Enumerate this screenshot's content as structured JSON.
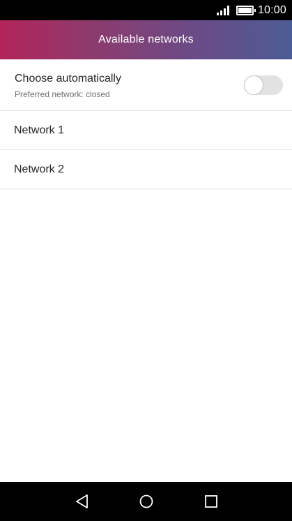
{
  "status_bar": {
    "time": "10:00",
    "icons": [
      "signal-icon",
      "battery-icon"
    ]
  },
  "header": {
    "title": "Available networks",
    "gradient_colors": [
      "#b2245a",
      "#6c4a86",
      "#4c5c94"
    ]
  },
  "auto_select": {
    "title": "Choose automatically",
    "subtitle": "Preferred network: closed",
    "toggle_on": false
  },
  "networks": [
    {
      "label": "Network 1"
    },
    {
      "label": "Network 2"
    }
  ],
  "nav_bar": {
    "icons": [
      "back-icon",
      "home-icon",
      "recents-icon"
    ]
  }
}
